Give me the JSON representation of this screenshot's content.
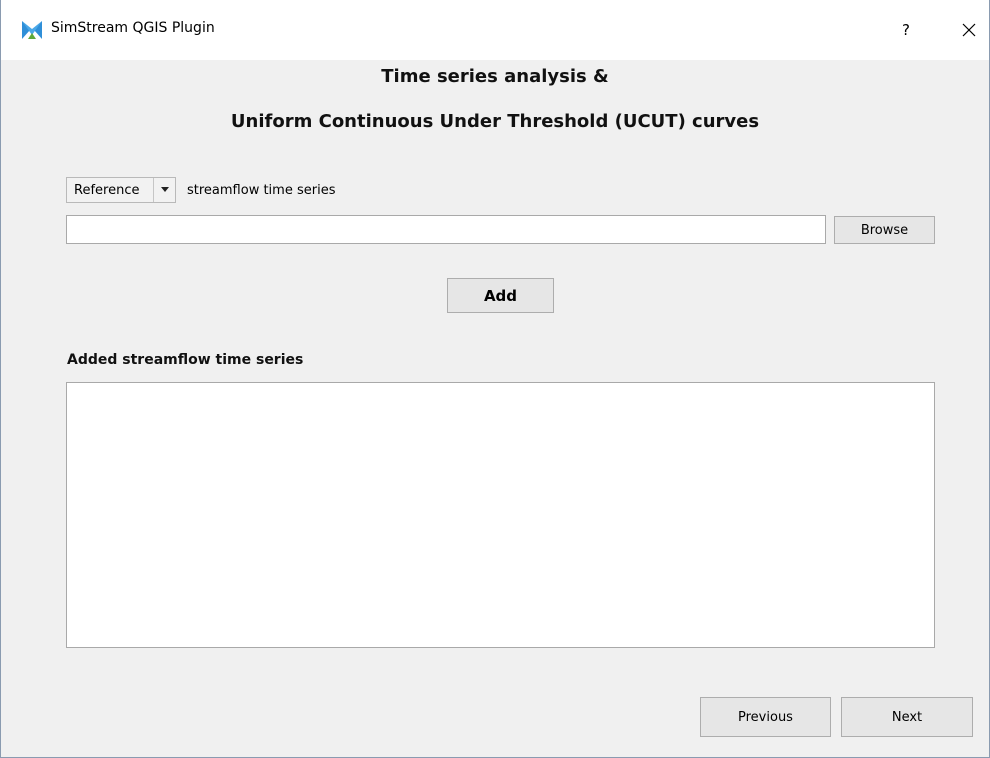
{
  "window": {
    "title": "SimStream QGIS Plugin",
    "help_label": "?",
    "app_icon": "simstream-logo-icon",
    "close_icon": "close-icon"
  },
  "header": {
    "line1": "Time series analysis &",
    "line2": "Uniform Continuous Under Threshold (UCUT) curves"
  },
  "series_input": {
    "type_selected": "Reference",
    "type_label": "streamflow time series",
    "path_value": "",
    "browse_label": "Browse",
    "add_label": "Add"
  },
  "added_list": {
    "label": "Added streamflow time series",
    "items": []
  },
  "footer": {
    "previous_label": "Previous",
    "next_label": "Next"
  },
  "colors": {
    "dialog_background": "#f0f0f0",
    "titlebar_background": "#ffffff",
    "button_face": "#e6e6e6",
    "icon_blue": "#2f8fd8"
  }
}
